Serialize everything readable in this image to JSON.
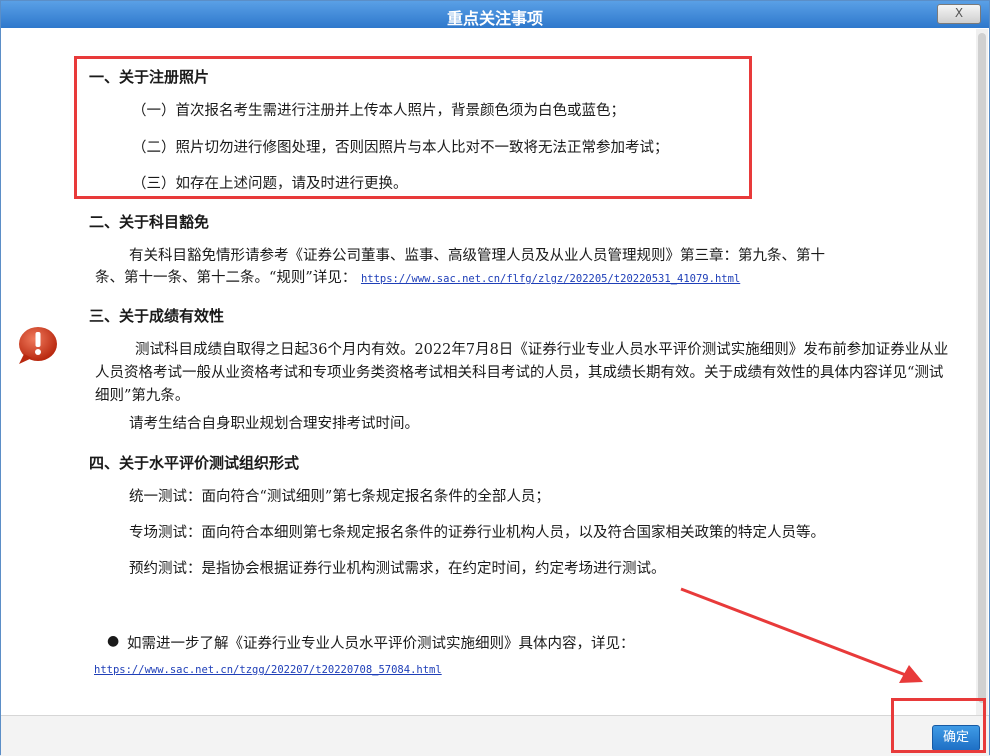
{
  "window": {
    "title": "重点关注事项",
    "close_label": "X"
  },
  "sections": [
    {
      "title": "一、关于注册照片",
      "items": [
        "（一）首次报名考生需进行注册并上传本人照片，背景颜色须为白色或蓝色；",
        "（二）照片切勿进行修图处理，否则因照片与本人比对不一致将无法正常参加考试；",
        "（三）如存在上述问题，请及时进行更换。"
      ]
    },
    {
      "title": "二、关于科目豁免",
      "text_line1": "有关科目豁免情形请参考《证券公司董事、监事、高级管理人员及从业人员管理规则》第三章：第九条、第十",
      "text_line2": "条、第十一条、第十二条。“规则”详见：",
      "link": "https://www.sac.net.cn/flfg/zlgz/202205/t20220531_41079.html"
    },
    {
      "title": "三、关于成绩有效性",
      "text": "测试科目成绩自取得之日起36个月内有效。2022年7月8日《证券行业专业人员水平评价测试实施细则》发布前参加证券业从业人员资格考试一般从业资格考试和专项业务类资格考试相关科目考试的人员，其成绩长期有效。关于成绩有效性的具体内容详见“测试细则”第九条。",
      "text2": "请考生结合自身职业规划合理安排考试时间。"
    },
    {
      "title": "四、关于水平评价测试组织形式",
      "items": [
        "统一测试：面向符合“测试细则”第七条规定报名条件的全部人员；",
        "专场测试：面向符合本细则第七条规定报名条件的证券行业机构人员，以及符合国家相关政策的特定人员等。",
        "预约测试：是指协会根据证券行业机构测试需求，在约定时间，约定考场进行测试。"
      ]
    }
  ],
  "note": {
    "text": "如需进一步了解《证券行业专业人员水平评价测试实施细则》具体内容，详见：",
    "link": "https://www.sac.net.cn/tzgg/202207/t20220708_57084.html"
  },
  "footer": {
    "ok_label": "确定"
  },
  "colors": {
    "title_bar": "#2e78cc",
    "highlight": "#e83a3a",
    "link": "#1f3fb8",
    "icon": "#d23b1f"
  },
  "icons": {
    "warning": "exclamation-bubble-icon"
  }
}
